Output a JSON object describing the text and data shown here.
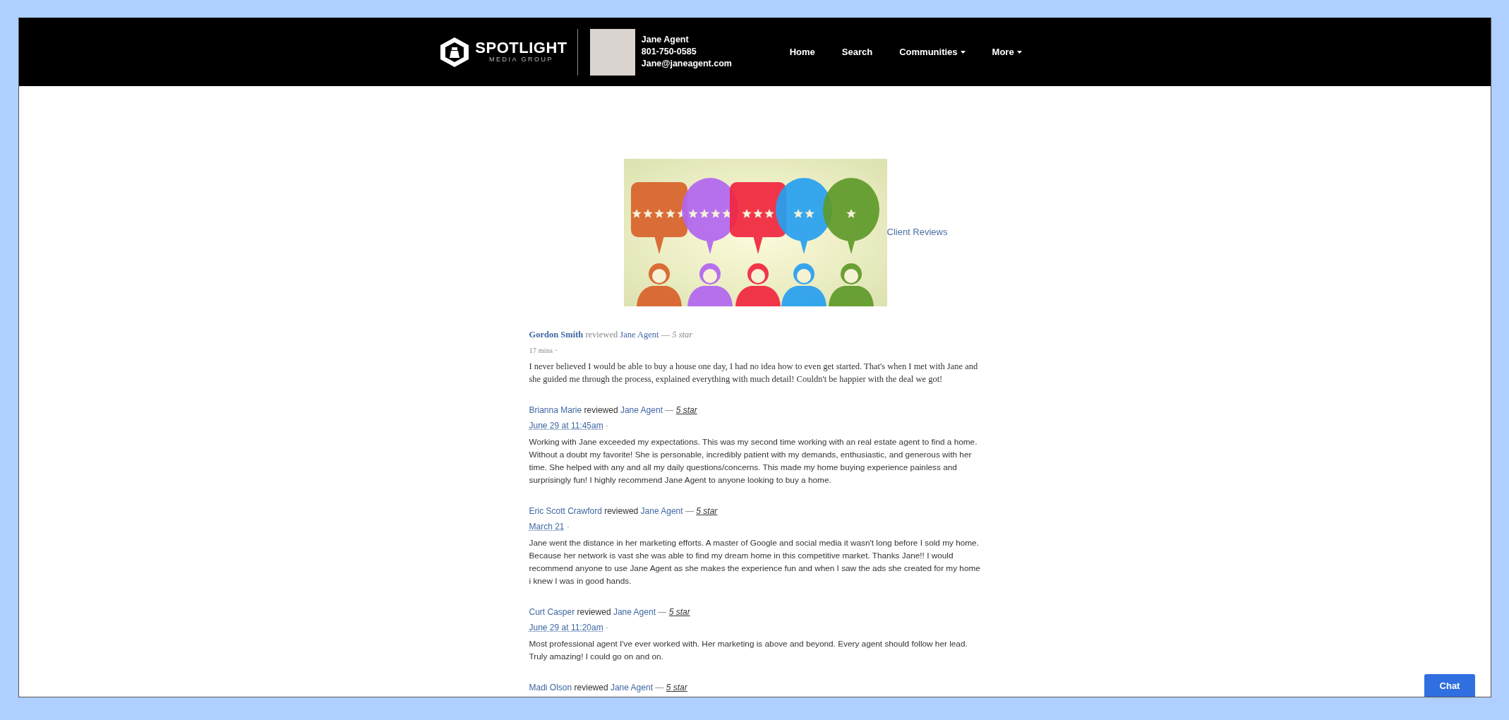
{
  "brand": {
    "name": "SPOTLIGHT",
    "tagline": "MEDIA GROUP"
  },
  "agent": {
    "name": "Jane Agent",
    "phone": "801-750-0585",
    "email": "Jane@janeagent.com"
  },
  "nav": [
    {
      "label": "Home",
      "has_menu": false
    },
    {
      "label": "Search",
      "has_menu": false
    },
    {
      "label": "Communities",
      "has_menu": true
    },
    {
      "label": "More",
      "has_menu": true
    }
  ],
  "banner": {
    "link": "Client Reviews"
  },
  "reviews": [
    {
      "kind": "serif",
      "reviewer": "Gordon Smith",
      "verb": "reviewed",
      "target": "Jane Agent",
      "dash": "—",
      "rating": "5 star",
      "time": "17 mins",
      "dot": "·",
      "body": "I never believed I would be able to buy a house one day, I had no idea how to even get started. That's when I met with Jane and she guided me through the process, explained everything with much detail! Couldn't be happier with the deal we got!"
    },
    {
      "kind": "sans",
      "reviewer": "Brianna Marie",
      "verb": "reviewed",
      "target": "Jane Agent",
      "dash": "—",
      "rating": "5 star",
      "time": "June 29 at 11:45am",
      "dot": "·",
      "body": "Working with Jane exceeded my expectations. This was my second time working with an real estate agent to find a home. Without a doubt my favorite! She is personable, incredibly patient with my demands, enthusiastic, and generous with her time. She helped with any and all my daily questions/concerns. This made my home buying experience painless and surprisingly fun! I highly recommend Jane Agent to anyone looking to buy a home."
    },
    {
      "kind": "sans",
      "reviewer": "Eric Scott Crawford",
      "verb": "reviewed",
      "target": "Jane Agent",
      "dash": "—",
      "rating": "5 star",
      "time": "March 21",
      "dot": "·",
      "body": "Jane went the distance in her marketing efforts. A master of Google and social media it wasn't long before I sold my home. Because her network is vast she was able to find my dream home in this competitive market. Thanks Jane!! I would recommend anyone to use Jane Agent as she makes the experience fun and when I saw the ads she created for my home i knew I was in good hands."
    },
    {
      "kind": "sans",
      "reviewer": "Curt Casper",
      "verb": "reviewed",
      "target": "Jane Agent",
      "dash": "—",
      "rating": "5 star",
      "time": "June 29 at 11:20am",
      "dot": "·",
      "body": "Most professional agent I've ever worked with. Her marketing is above and beyond. Every agent should follow her lead. Truly amazing! I could go on and on."
    },
    {
      "kind": "sans",
      "reviewer": "Madi Olson",
      "verb": "reviewed",
      "target": "Jane Agent",
      "dash": "—",
      "rating": "5 star"
    }
  ],
  "chat": {
    "label": "Chat"
  }
}
